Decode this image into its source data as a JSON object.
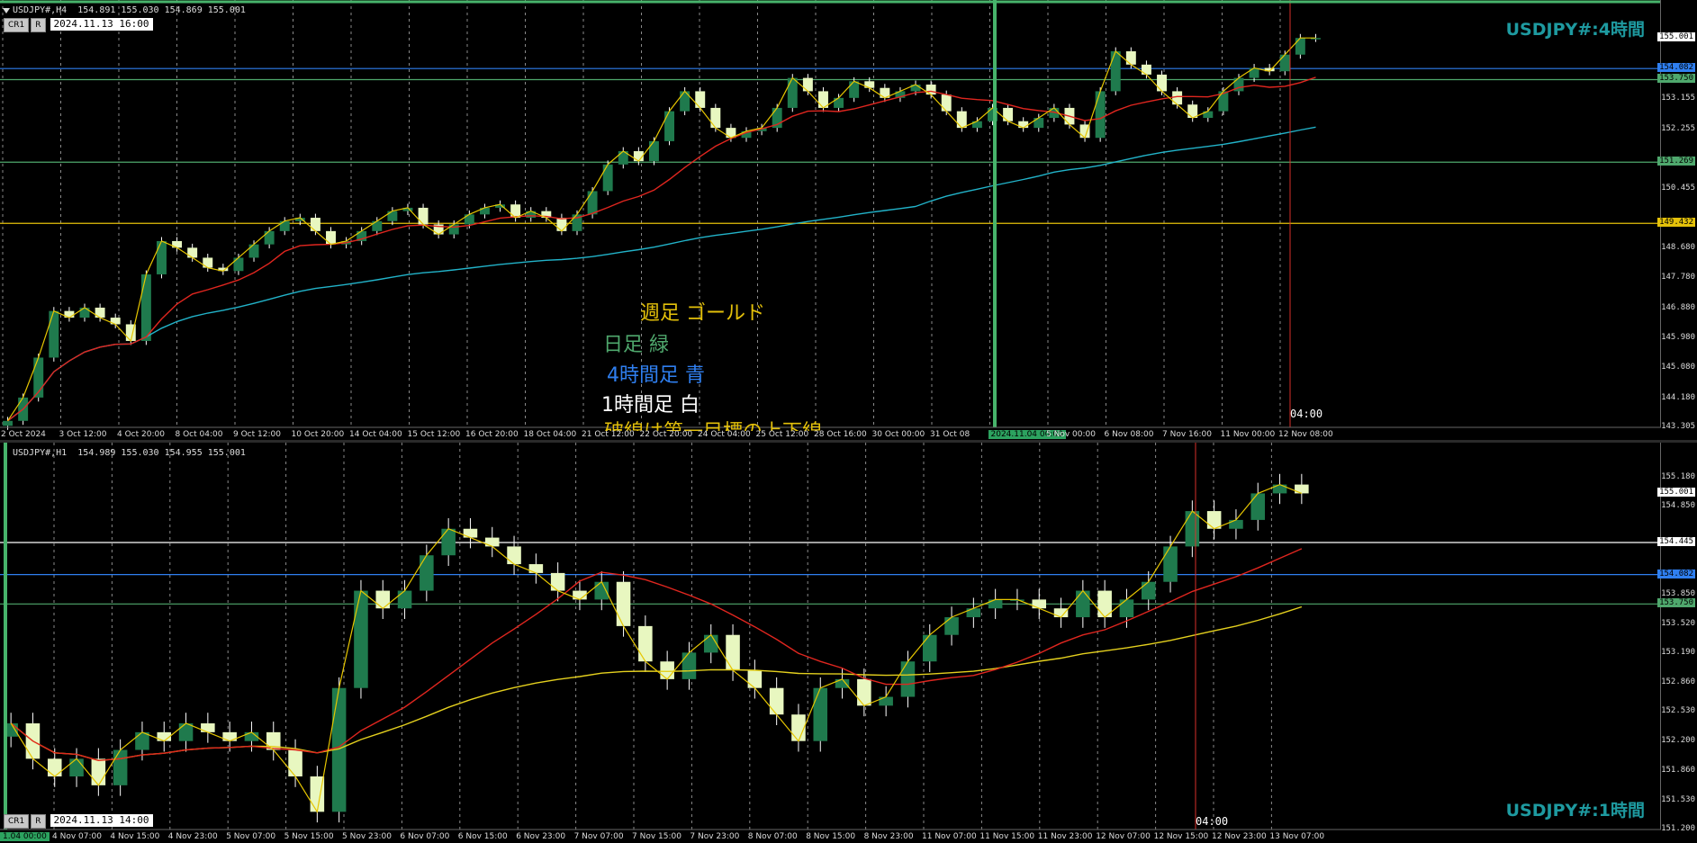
{
  "colors": {
    "bull": "#1f7a4d",
    "bear": "#e8f7c0",
    "wick": "#ffffff",
    "ma_fast": "#e0261f",
    "ma_slow_h4": "#22b3c9",
    "ma_slow_h1": "#e4d01e",
    "zigzag": "#e6c600",
    "weekly": "#e4c10a",
    "daily": "#4fa86d",
    "h4": "#2f7ff0",
    "h1": "#ffffff",
    "title": "#1e9aa0",
    "red_vline": "#d9302a",
    "green_vline": "#47b36b"
  },
  "icons": {
    "collapse": "triangle-down-icon"
  },
  "pane_h4": {
    "header": "USDJPY#,H4  154.891 155.030 154.869 155.001",
    "btn_cr1": "CR1",
    "btn_r": "R",
    "datetime": "2024.11.13 16:00",
    "title": "USDJPY#:4時間",
    "legend": {
      "weekly": "週足  ゴールド",
      "daily": "日足  緑",
      "h4": "4時間足  青",
      "h1": "1時間足  白",
      "cut": "破線は第一目標の上下線"
    },
    "cursor_time": "04:00",
    "price_labels": [
      "155.001",
      "154.082",
      "153.750",
      "153.155",
      "152.255",
      "151.269",
      "150.455",
      "149.432",
      "148.680",
      "147.780",
      "146.880",
      "145.980",
      "145.080",
      "144.180",
      "143.305"
    ],
    "time_labels": [
      "2 Oct 2024",
      "3 Oct 12:00",
      "4 Oct 20:00",
      "8 Oct 04:00",
      "9 Oct 12:00",
      "10 Oct 20:00",
      "14 Oct 04:00",
      "15 Oct 12:00",
      "16 Oct 20:00",
      "18 Oct 04:00",
      "21 Oct 12:00",
      "22 Oct 20:00",
      "24 Oct 04:00",
      "25 Oct 12:00",
      "28 Oct 16:00",
      "30 Oct 00:00",
      "31 Oct 08",
      "2024.11.04 00:00",
      "5 Nov 00:00",
      "6 Nov 08:00",
      "7 Nov 16:00",
      "11 Nov 00:00",
      "12 Nov 08:00"
    ],
    "levels": [
      {
        "value": "154.082",
        "color": "#2f7ff0"
      },
      {
        "value": "153.750",
        "color": "#4fa86d"
      },
      {
        "value": "151.269",
        "color": "#4fa86d"
      },
      {
        "value": "149.432",
        "color": "#e4c10a"
      }
    ],
    "chart_data": {
      "type": "line",
      "ylim": [
        143.305,
        155.6
      ],
      "close": [
        143.5,
        144.2,
        145.4,
        146.8,
        146.6,
        146.9,
        146.6,
        146.4,
        145.9,
        147.9,
        148.9,
        148.7,
        148.4,
        148.1,
        148.0,
        148.4,
        148.8,
        149.2,
        149.5,
        149.6,
        149.2,
        148.8,
        148.9,
        149.2,
        149.5,
        149.8,
        149.9,
        149.4,
        149.1,
        149.4,
        149.7,
        149.9,
        150.0,
        149.6,
        149.8,
        149.6,
        149.2,
        149.7,
        150.4,
        151.2,
        151.6,
        151.3,
        151.9,
        152.8,
        153.4,
        152.9,
        152.3,
        152.0,
        152.2,
        152.3,
        152.9,
        153.8,
        153.4,
        152.9,
        153.2,
        153.7,
        153.5,
        153.2,
        153.4,
        153.6,
        153.3,
        152.8,
        152.3,
        152.5,
        152.9,
        152.5,
        152.3,
        152.6,
        152.9,
        152.4,
        152.0,
        153.4,
        154.6,
        154.2,
        153.9,
        153.4,
        153.0,
        152.6,
        152.8,
        153.4,
        153.8,
        154.1,
        154.0,
        154.5,
        155.0,
        155.0
      ]
    }
  },
  "pane_h1": {
    "header": "USDJPY#,H1  154.989 155.030 154.955 155.001",
    "btn_cr1": "CR1",
    "btn_r": "R",
    "datetime": "2024.11.13 14:00",
    "title": "USDJPY#:1時間",
    "cursor_time": "04:00",
    "price_labels": [
      "155.180",
      "155.001",
      "154.850",
      "154.445",
      "154.082",
      "153.850",
      "153.750",
      "153.520",
      "153.190",
      "152.860",
      "152.530",
      "152.200",
      "151.860",
      "151.530",
      "151.200"
    ],
    "time_labels": [
      "4 Nov 07:00",
      "4 Nov 15:00",
      "4 Nov 23:00",
      "5 Nov 07:00",
      "5 Nov 15:00",
      "5 Nov 23:00",
      "6 Nov 07:00",
      "6 Nov 15:00",
      "6 Nov 23:00",
      "7 Nov 07:00",
      "7 Nov 15:00",
      "7 Nov 23:00",
      "8 Nov 07:00",
      "8 Nov 15:00",
      "8 Nov 23:00",
      "11 Nov 07:00",
      "11 Nov 15:00",
      "11 Nov 23:00",
      "12 Nov 07:00",
      "12 Nov 15:00",
      "12 Nov 23:00",
      "13 Nov 07:00"
    ],
    "first_time": "1.04 00:00",
    "levels": [
      {
        "value": "154.445",
        "color": "#ffffff"
      },
      {
        "value": "154.082",
        "color": "#2f7ff0"
      },
      {
        "value": "153.750",
        "color": "#4fa86d"
      }
    ],
    "chart_data": {
      "type": "line",
      "ylim": [
        151.2,
        155.35
      ],
      "close": [
        152.4,
        152.0,
        151.8,
        152.0,
        151.7,
        152.1,
        152.3,
        152.2,
        152.4,
        152.3,
        152.2,
        152.3,
        152.1,
        151.8,
        151.4,
        152.8,
        153.9,
        153.7,
        153.9,
        154.3,
        154.6,
        154.5,
        154.4,
        154.2,
        154.1,
        153.9,
        153.8,
        154.0,
        153.5,
        153.1,
        152.9,
        153.2,
        153.4,
        153.0,
        152.8,
        152.5,
        152.2,
        152.8,
        152.9,
        152.6,
        152.7,
        153.1,
        153.4,
        153.6,
        153.7,
        153.8,
        153.8,
        153.7,
        153.6,
        153.9,
        153.6,
        153.8,
        154.0,
        154.4,
        154.8,
        154.6,
        154.7,
        155.0,
        155.1,
        155.0
      ]
    }
  }
}
